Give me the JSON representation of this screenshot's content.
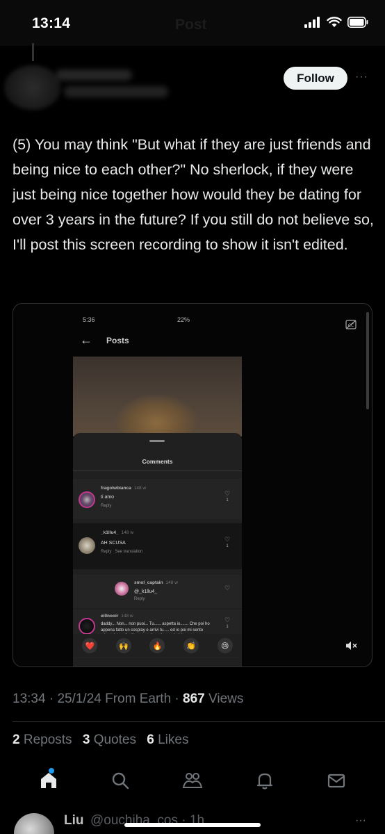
{
  "status_bar": {
    "time": "13:14",
    "ghost_title": "Post"
  },
  "author": {
    "follow_label": "Follow",
    "more_label": "···"
  },
  "post": {
    "text": "(5) You may think \"But what if they are just friends and being nice to each other?\" No sherlock, if they were just being nice together how would they be dating for over 3 years in the future? If you still do not believe so, I'll post this screen recording to show it isn't edited."
  },
  "video": {
    "status_time": "5:36",
    "status_right": "22%",
    "nav_title": "Posts",
    "sheet_title": "Comments",
    "comments": [
      {
        "user": "fragolwbianca",
        "time": "148 w",
        "text": "ti amo",
        "reply": "Reply",
        "likes": "1"
      },
      {
        "user": "_k1llu4_",
        "time": "148 w",
        "text": "AH SCUSA",
        "reply": "Reply   See translation",
        "likes": "1"
      },
      {
        "user": "smol_captain",
        "time": "148 w",
        "text": "@_k1llu4_",
        "reply": "Reply",
        "likes": ""
      },
      {
        "user": "eillnooir",
        "time": "148 w",
        "text": "daddy... Non... non puoi... Tu...... aspetta io....... Che poi ho appena fatto un cosplay e arrivi tu..... ed io poi mi sento minacciata a livello ormonale.... ti amo daddy.......",
        "reply": "",
        "likes": "1"
      }
    ],
    "emojis": [
      "❤️",
      "🙌",
      "🔥",
      "👏",
      "😢"
    ]
  },
  "meta": {
    "time": "13:34",
    "date": "25/1/24",
    "location": "From Earth",
    "views_count": "867",
    "views_label": "Views"
  },
  "stats": {
    "reposts_count": "2",
    "reposts_label": "Reposts",
    "quotes_count": "3",
    "quotes_label": "Quotes",
    "likes_count": "6",
    "likes_label": "Likes"
  },
  "tabs": [
    "home-icon",
    "search-icon",
    "communities-icon",
    "notifications-icon",
    "messages-icon"
  ],
  "reply_preview": {
    "name": "Liu",
    "handle": "@ouchiha_cos",
    "time": "1h",
    "more_label": "···"
  },
  "colors": {
    "background": "#000000",
    "text": "#e7e9ea",
    "muted": "#71767b",
    "accent": "#1d9bf0",
    "divider": "#2f3336"
  }
}
